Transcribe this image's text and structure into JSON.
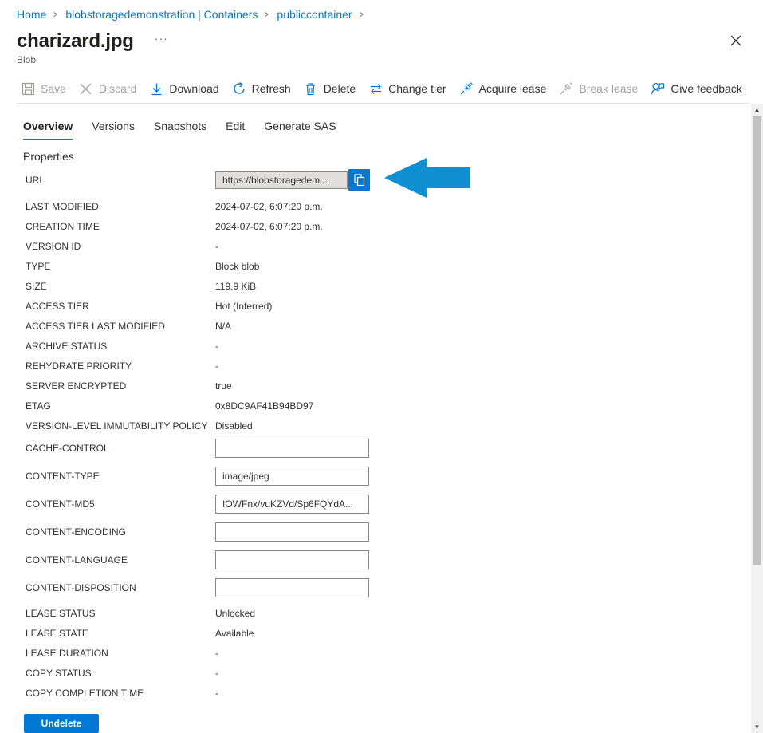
{
  "breadcrumb": [
    "Home",
    "blobstoragedemonstration | Containers",
    "publiccontainer"
  ],
  "header": {
    "title": "charizard.jpg",
    "more": "···",
    "subtitle": "Blob"
  },
  "toolbar": {
    "save": "Save",
    "discard": "Discard",
    "download": "Download",
    "refresh": "Refresh",
    "delete": "Delete",
    "change_tier": "Change tier",
    "acquire_lease": "Acquire lease",
    "break_lease": "Break lease",
    "give_feedback": "Give feedback"
  },
  "tabs": [
    "Overview",
    "Versions",
    "Snapshots",
    "Edit",
    "Generate SAS"
  ],
  "section_title": "Properties",
  "properties": {
    "url_label": "URL",
    "url_value": "https://blobstoragedem...",
    "static": [
      {
        "label": "LAST MODIFIED",
        "value": "2024-07-02, 6:07:20 p.m."
      },
      {
        "label": "CREATION TIME",
        "value": "2024-07-02, 6:07:20 p.m."
      },
      {
        "label": "VERSION ID",
        "value": "-"
      },
      {
        "label": "TYPE",
        "value": "Block blob"
      },
      {
        "label": "SIZE",
        "value": "119.9 KiB"
      },
      {
        "label": "ACCESS TIER",
        "value": "Hot (Inferred)"
      },
      {
        "label": "ACCESS TIER LAST MODIFIED",
        "value": "N/A"
      },
      {
        "label": "ARCHIVE STATUS",
        "value": "-"
      },
      {
        "label": "REHYDRATE PRIORITY",
        "value": "-"
      },
      {
        "label": "SERVER ENCRYPTED",
        "value": "true"
      },
      {
        "label": "ETAG",
        "value": "0x8DC9AF41B94BD97"
      },
      {
        "label": "VERSION-LEVEL IMMUTABILITY POLICY",
        "value": "Disabled"
      }
    ],
    "editable": [
      {
        "label": "CACHE-CONTROL",
        "value": ""
      },
      {
        "label": "CONTENT-TYPE",
        "value": "image/jpeg"
      },
      {
        "label": "CONTENT-MD5",
        "value": "IOWFnx/vuKZVd/Sp6FQYdA..."
      },
      {
        "label": "CONTENT-ENCODING",
        "value": ""
      },
      {
        "label": "CONTENT-LANGUAGE",
        "value": ""
      },
      {
        "label": "CONTENT-DISPOSITION",
        "value": ""
      }
    ],
    "lease": [
      {
        "label": "LEASE STATUS",
        "value": "Unlocked"
      },
      {
        "label": "LEASE STATE",
        "value": "Available"
      },
      {
        "label": "LEASE DURATION",
        "value": "-"
      },
      {
        "label": "COPY STATUS",
        "value": "-"
      },
      {
        "label": "COPY COMPLETION TIME",
        "value": "-"
      }
    ]
  },
  "undelete_label": "Undelete",
  "colors": {
    "accent": "#0078d4",
    "arrow": "#0e90d2",
    "disabled": "#a19f9d"
  },
  "icons": {
    "copy": "copy-icon",
    "close": "close-icon",
    "save": "save-icon",
    "discard": "discard-icon",
    "download": "download-icon",
    "refresh": "refresh-icon",
    "delete": "delete-icon",
    "change_tier": "change-tier-icon",
    "acquire_lease": "acquire-lease-icon",
    "break_lease": "break-lease-icon",
    "feedback": "feedback-icon",
    "arrow": "arrow-annotation-icon"
  }
}
